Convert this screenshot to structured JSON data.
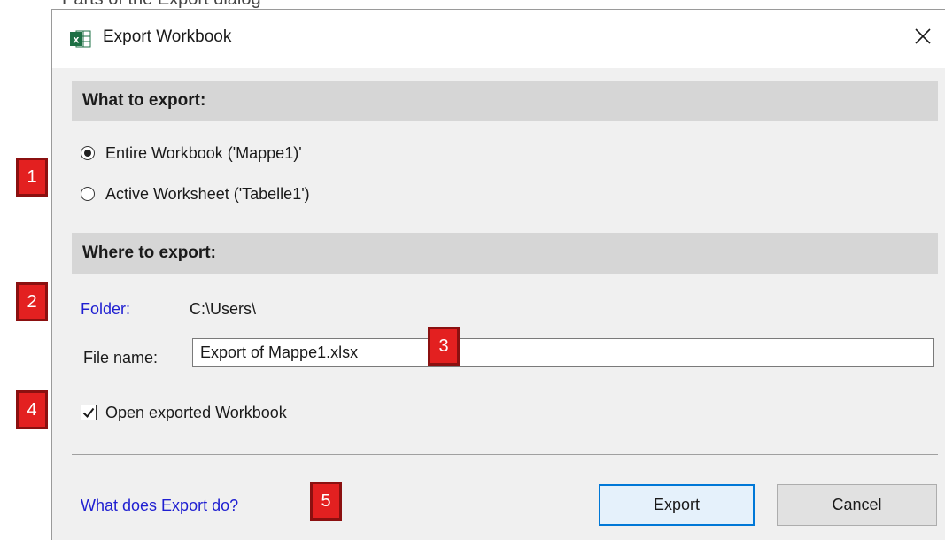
{
  "caption_fragment": "Parts of the Export dialog",
  "dialog": {
    "title": "Export Workbook",
    "app_icon_letter": "x",
    "close_glyph": "✕"
  },
  "what_section": {
    "header": "What to export:",
    "options": [
      {
        "label": "Entire Workbook ('Mappe1)'",
        "selected": true
      },
      {
        "label": "Active Worksheet ('Tabelle1')",
        "selected": false
      }
    ]
  },
  "where_section": {
    "header": "Where to export:",
    "folder_label": "Folder:",
    "folder_value": "C:\\Users\\",
    "file_name_label": "File name:",
    "file_name_value": "Export of Mappe1.xlsx"
  },
  "open_exported": {
    "label": "Open exported Workbook",
    "checked": true
  },
  "footer": {
    "help_link": "What does Export do?",
    "export_button": "Export",
    "cancel_button": "Cancel"
  },
  "callouts": [
    "1",
    "2",
    "3",
    "4",
    "5"
  ],
  "colors": {
    "accent": "#0078d7",
    "link": "#1f1fd1",
    "callout_fill": "#e32020",
    "excel_green": "#1d7044"
  }
}
